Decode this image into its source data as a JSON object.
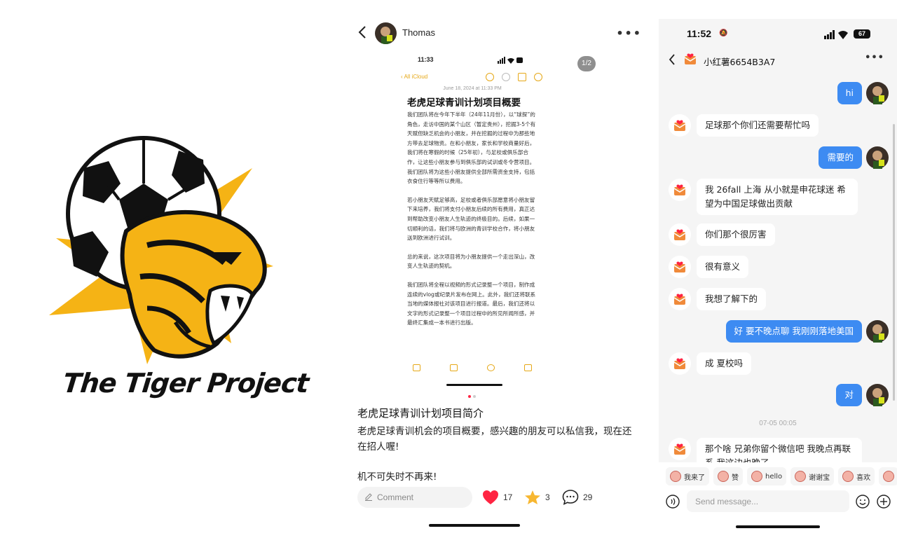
{
  "logo": {
    "text": "The Tiger Project",
    "colors": {
      "gold": "#f5b315",
      "black": "#111111"
    }
  },
  "post": {
    "author": "Thomas",
    "page_indicator": "1/2",
    "screenshot": {
      "time": "11:33",
      "battery": "5",
      "back_label": "All iCloud",
      "date": "June 18, 2024 at 11:33 PM",
      "title": "老虎足球青训计划项目概要",
      "paragraphs": [
        "我们团队将在今年下半年（24年11月份），以“球探”的角色，走访中国的某个山区（暂定贵州），挖掘3-5个有天赋但缺乏机会的小朋友，并在挖掘的过程中为那些地方带去足球物资。在和小朋友，家长和学校商量好后，我们将在寒假的时候（25年初），与足校或俱乐部合作，让这些小朋友参与到俱乐部的试训或冬令营项目。我们团队将为这些小朋友提供全部所需资金支持，包括衣食住行等等所以费用。",
        "若小朋友天赋足够高，足校或者俱乐部愿意将小朋友留下来培养，我们将支付小朋友后续的所有费用，真正达到帮助改变小朋友人生轨迹的终极目的。后续，如果一切顺利的话，我们将与欧洲的青训学校合作，将小朋友送到欧洲进行试训。",
        "总的来说，这次项目将为小朋友提供一个走出深山，改变人生轨迹的契机。",
        "我们团队将全程以视频的形式记录整一个项目，制作成连续的vlog或纪录片发布在网上。此外，我们还将联系当地的媒体报社对该项目进行报道。最后，我们还将以文字的形式记录整一个项目过程中的所见所闻所感，并最终汇集成一本书进行出版。"
      ]
    },
    "title": "老虎足球青训计划项目简介",
    "description": "老虎足球青训机会的项目概要，感兴趣的朋友可以私信我，现在还在招人喔!",
    "cta": "机不可失时不再来!",
    "comment_placeholder": "Comment",
    "likes": "17",
    "stars": "3",
    "comments": "29",
    "colors": {
      "like": "#ff2442",
      "star": "#f7b731",
      "ios_note_accent": "#e6a817"
    }
  },
  "chat": {
    "time": "11:52",
    "battery": "67",
    "contact_name": "小红薯6654B3A7",
    "messages": [
      {
        "dir": "out",
        "text": "hi"
      },
      {
        "dir": "in",
        "text": "足球那个你们还需要帮忙吗"
      },
      {
        "dir": "out",
        "text": "需要的"
      },
      {
        "dir": "in",
        "text": "我 26fall 上海 从小就是申花球迷 希望为中国足球做出贡献"
      },
      {
        "dir": "in",
        "text": "你们那个很厉害"
      },
      {
        "dir": "in",
        "text": "很有意义"
      },
      {
        "dir": "in",
        "text": "我想了解下的"
      },
      {
        "dir": "out",
        "text": "好 要不晚点聊 我刚刚落地美国"
      },
      {
        "dir": "in",
        "text": "成 夏校吗"
      },
      {
        "dir": "out",
        "text": "对"
      },
      {
        "dir": "in",
        "text": "那个啥 兄弟你留个微信吧 我晚点再联系 我这边也晚了"
      }
    ],
    "timestamp": "07-05 00:05",
    "stickers": [
      "我来了",
      "赞",
      "hello",
      "谢谢宝",
      "喜欢"
    ],
    "input_placeholder": "Send message...",
    "colors": {
      "out_bubble": "#3d8bf2",
      "in_bubble": "#ffffff",
      "background": "#f5f5f5"
    }
  }
}
